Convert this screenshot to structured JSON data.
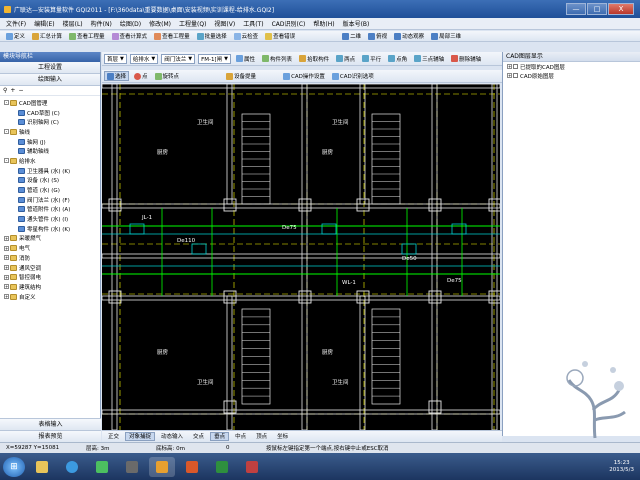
{
  "window": {
    "title": "广联达—安装算量软件 GQI2011 - [F:\\360data\\重要数据\\桌面\\安装视频\\实训课程-给排水.GQI2]",
    "min": "—",
    "max": "□",
    "close": "X"
  },
  "menubar": [
    "文件(F)",
    "编辑(E)",
    "楼层(L)",
    "构件(N)",
    "绘图(D)",
    "修改(M)",
    "工程量(Q)",
    "视图(V)",
    "工具(T)",
    "CAD识别(C)",
    "帮助(H)",
    "版本号(B)"
  ],
  "toolbar1": [
    "定义",
    "汇总计算",
    "查看工程量",
    "查看计算式",
    "查看工程量",
    "批量选择",
    "云检查",
    "查看错误",
    "二维",
    "俯视",
    "动态观察",
    "局部三维"
  ],
  "toolbar2": {
    "floor": "首层",
    "category": "给排水",
    "type": "阀门法兰",
    "component": "FM-1[闸",
    "buttons": [
      "属性",
      "构件列表",
      "拾取构件",
      "两点",
      "平行",
      "点角",
      "三点辅轴",
      "删除辅轴",
      "尺寸标注"
    ]
  },
  "toolbar3": {
    "buttons": [
      "选择",
      "点",
      "旋转点",
      "设备提量",
      "CAD操作设置",
      "CAD识别选项"
    ]
  },
  "leftpanel": {
    "header": "模块导航栏",
    "top_buttons": [
      "工程设置",
      "绘图输入"
    ],
    "tree": [
      {
        "label": "CAD图管理",
        "level": 1,
        "kind": "folder",
        "exp": "-"
      },
      {
        "label": "CAD草图 (C)",
        "level": 2,
        "kind": "leaf"
      },
      {
        "label": "识别轴网 (C)",
        "level": 2,
        "kind": "leaf"
      },
      {
        "label": "轴线",
        "level": 1,
        "kind": "folder",
        "exp": "-"
      },
      {
        "label": "轴网 (J)",
        "level": 2,
        "kind": "leaf"
      },
      {
        "label": "辅助轴线",
        "level": 2,
        "kind": "leaf"
      },
      {
        "label": "给排水",
        "level": 1,
        "kind": "folder",
        "exp": "-"
      },
      {
        "label": "卫生器具 (水) (K)",
        "level": 2,
        "kind": "leaf"
      },
      {
        "label": "设备 (水) (S)",
        "level": 2,
        "kind": "leaf"
      },
      {
        "label": "管道 (水) (G)",
        "level": 2,
        "kind": "leaf"
      },
      {
        "label": "阀门法兰 (水) (F)",
        "level": 2,
        "kind": "leaf"
      },
      {
        "label": "管道附件 (水) (A)",
        "level": 2,
        "kind": "leaf"
      },
      {
        "label": "通头管件 (水) (I)",
        "level": 2,
        "kind": "leaf"
      },
      {
        "label": "零星构件 (水) (K)",
        "level": 2,
        "kind": "leaf"
      },
      {
        "label": "采暖燃气",
        "level": 1,
        "kind": "folder",
        "exp": "+"
      },
      {
        "label": "电气",
        "level": 1,
        "kind": "folder",
        "exp": "+"
      },
      {
        "label": "消防",
        "level": 1,
        "kind": "folder",
        "exp": "+"
      },
      {
        "label": "通风空调",
        "level": 1,
        "kind": "folder",
        "exp": "+"
      },
      {
        "label": "智控弱电",
        "level": 1,
        "kind": "folder",
        "exp": "+"
      },
      {
        "label": "建筑结构",
        "level": 1,
        "kind": "folder",
        "exp": "+"
      },
      {
        "label": "自定义",
        "level": 1,
        "kind": "folder",
        "exp": "+"
      }
    ],
    "bottom_buttons": [
      "表格输入",
      "报表预览"
    ]
  },
  "rightpanel": {
    "header": "CAD图层显示",
    "items": [
      "已提取的CAD图层",
      "CAD原始图层"
    ]
  },
  "canvas": {
    "labels": [
      "厨房",
      "卫生间",
      "厨房",
      "卫生间",
      "厨房",
      "卫生间",
      "厨房",
      "卫生间",
      "JL-1",
      "WL-1",
      "De110",
      "De50",
      "De75",
      "De75"
    ]
  },
  "bottombar": [
    "正交",
    "对象捕捉",
    "动态输入",
    "交点",
    "垂点",
    "中点",
    "顶点",
    "坐标"
  ],
  "statusbar": {
    "coords": "X=59287 Y=15081",
    "floor_height": "层高: 3m",
    "base_elev": "底标高: 0m",
    "value": "0",
    "hint": "按鼠标左键指定第一个端点,按右键中止或ESC取消"
  },
  "taskbar": {
    "time": "15:23",
    "date": "2013/5/3"
  },
  "colors": {
    "canvas_bg": "#000000",
    "wall": "#e8e8e8",
    "grid": "#ffff00",
    "pipe_green": "#00ff00",
    "pipe_cyan": "#00d0d0",
    "accent": "#3864a8"
  }
}
